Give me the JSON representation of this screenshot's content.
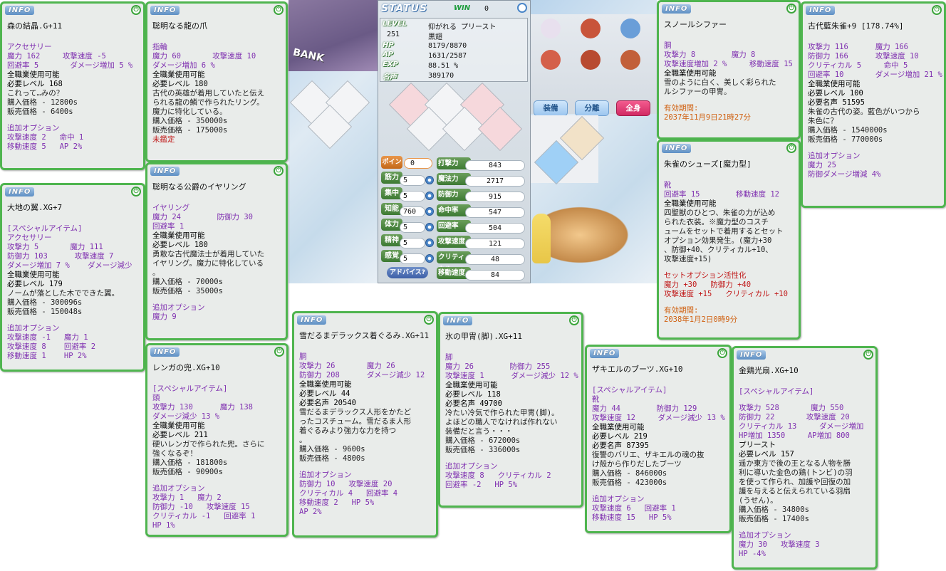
{
  "ui": {
    "info_label": "INFO",
    "power_icon": "power-icon"
  },
  "scene": {
    "bank_sign": "BANK"
  },
  "status": {
    "title": "STATUS",
    "win_label": "WIN",
    "win_value": "0",
    "level_label": "LEVEL",
    "level": "251",
    "title_text": "仰がれる プリースト",
    "name": "黒翅",
    "hp_label": "HP",
    "hp": "8179/8870",
    "ap_label": "AP",
    "ap": "1631/2587",
    "exp_label": "EXP",
    "exp": "88.51 %",
    "fame_label": "名声",
    "fame": "389170",
    "point_label": "ポイント",
    "points": "0",
    "stats": [
      {
        "label": "筋力",
        "value": "5"
      },
      {
        "label": "集中",
        "value": "5"
      },
      {
        "label": "知能",
        "value": "760"
      },
      {
        "label": "体力",
        "value": "5"
      },
      {
        "label": "精神",
        "value": "5"
      },
      {
        "label": "感覚",
        "value": "5"
      }
    ],
    "derived": [
      {
        "label": "打撃力",
        "value": "843"
      },
      {
        "label": "魔法力",
        "value": "2717"
      },
      {
        "label": "防御力",
        "value": "915"
      },
      {
        "label": "命中率",
        "value": "547"
      },
      {
        "label": "回避率",
        "value": "504"
      },
      {
        "label": "攻撃速度",
        "value": "121"
      },
      {
        "label": "クリティカル",
        "value": "48"
      },
      {
        "label": "移動速度",
        "value": "84"
      }
    ],
    "advice_button": "アドバイス?"
  },
  "equip": {
    "tab_equip": "装備",
    "tab_split": "分離",
    "tab_all": "全身"
  },
  "w1": {
    "name": "森の結晶.G+11",
    "lines": [
      {
        "t": "",
        "c": "sp"
      },
      {
        "t": "アクセサリー",
        "c": "g"
      },
      {
        "t": "魔力 162     攻撃速度 -5",
        "c": "g"
      },
      {
        "t": "回避率 5       ダメージ増加 5 %",
        "c": "g"
      },
      {
        "t": "全職業使用可能",
        "c": "b"
      },
      {
        "t": "必要レベル 168",
        "c": "b"
      },
      {
        "t": "これって…みの？",
        "c": "d"
      },
      {
        "t": "購入価格 - 12800s",
        "c": "d"
      },
      {
        "t": "販売価格 - 6400s",
        "c": "d"
      },
      {
        "t": "",
        "c": "sp"
      },
      {
        "t": "追加オプション",
        "c": "g"
      },
      {
        "t": "攻撃速度 2   命中 1",
        "c": "g"
      },
      {
        "t": "移動速度 5   AP 2%",
        "c": "g"
      }
    ]
  },
  "w2": {
    "name": "聡明なる龍の爪",
    "lines": [
      {
        "t": "",
        "c": "sp"
      },
      {
        "t": "指輪",
        "c": "g"
      },
      {
        "t": "魔力 60       攻撃速度 10",
        "c": "g"
      },
      {
        "t": "ダメージ増加 6 %",
        "c": "g"
      },
      {
        "t": "全職業使用可能",
        "c": "b"
      },
      {
        "t": "必要レベル 180",
        "c": "b"
      },
      {
        "t": "古代の英雄が着用していたと伝え",
        "c": "d"
      },
      {
        "t": "られる龍の鱗で作られたリング。",
        "c": "d"
      },
      {
        "t": "魔力に特化している。",
        "c": "d"
      },
      {
        "t": "購入価格 - 350000s",
        "c": "d"
      },
      {
        "t": "販売価格 - 175000s",
        "c": "d"
      },
      {
        "t": "未鑑定",
        "c": "r"
      }
    ]
  },
  "w3": {
    "name": "大地の翼.XG+7",
    "lines": [
      {
        "t": "",
        "c": "sp"
      },
      {
        "t": "[スペシャルアイテム]",
        "c": "g"
      },
      {
        "t": "アクセサリー",
        "c": "g"
      },
      {
        "t": "攻撃力 5       魔力 111",
        "c": "g"
      },
      {
        "t": "防御力 103      攻撃速度 7",
        "c": "g"
      },
      {
        "t": "ダメージ増加 7 %    ダメージ減少",
        "c": "g"
      },
      {
        "t": "全職業使用可能",
        "c": "b"
      },
      {
        "t": "必要レベル 179",
        "c": "b"
      },
      {
        "t": "ノームが落とした木でできた翼。",
        "c": "d"
      },
      {
        "t": "購入価格 - 300096s",
        "c": "d"
      },
      {
        "t": "販売価格 - 150048s",
        "c": "d"
      },
      {
        "t": "",
        "c": "sp"
      },
      {
        "t": "追加オプション",
        "c": "g"
      },
      {
        "t": "攻撃速度 -1   魔力 1",
        "c": "g"
      },
      {
        "t": "攻撃速度 8    回避率 2",
        "c": "g"
      },
      {
        "t": "移動速度 1    HP 2%",
        "c": "g"
      }
    ]
  },
  "w4": {
    "name": "聡明なる公爵のイヤリング",
    "lines": [
      {
        "t": "",
        "c": "sp"
      },
      {
        "t": "イヤリング",
        "c": "g"
      },
      {
        "t": "魔力 24        防御力 30",
        "c": "g"
      },
      {
        "t": "回避率 1",
        "c": "g"
      },
      {
        "t": "全職業使用可能",
        "c": "b"
      },
      {
        "t": "必要レベル 180",
        "c": "b"
      },
      {
        "t": "勇敢な古代魔法士が着用していた",
        "c": "d"
      },
      {
        "t": "イヤリング。魔力に特化している",
        "c": "d"
      },
      {
        "t": "。",
        "c": "d"
      },
      {
        "t": "購入価格 - 70000s",
        "c": "d"
      },
      {
        "t": "販売価格 - 35000s",
        "c": "d"
      },
      {
        "t": "",
        "c": "sp"
      },
      {
        "t": "追加オプション",
        "c": "g"
      },
      {
        "t": "魔力 9",
        "c": "g"
      }
    ]
  },
  "w5": {
    "name": "レンガの兜.XG+10",
    "lines": [
      {
        "t": "",
        "c": "sp"
      },
      {
        "t": "[スペシャルアイテム]",
        "c": "g"
      },
      {
        "t": "頭",
        "c": "g"
      },
      {
        "t": "攻撃力 130      魔力 138",
        "c": "g"
      },
      {
        "t": "ダメージ減少 13 %",
        "c": "g"
      },
      {
        "t": "全職業使用可能",
        "c": "b"
      },
      {
        "t": "必要レベル 211",
        "c": "b"
      },
      {
        "t": "硬いレンガで作られた兜。さらに",
        "c": "d"
      },
      {
        "t": "強くなるぞ！",
        "c": "d"
      },
      {
        "t": "購入価格 - 181800s",
        "c": "d"
      },
      {
        "t": "販売価格 - 90900s",
        "c": "d"
      },
      {
        "t": "",
        "c": "sp"
      },
      {
        "t": "追加オプション",
        "c": "g"
      },
      {
        "t": "攻撃力 1   魔力 2",
        "c": "g"
      },
      {
        "t": "防御力 -10   攻撃速度 15",
        "c": "g"
      },
      {
        "t": "クリティカル -1   回避率 1",
        "c": "g"
      },
      {
        "t": "HP 1%",
        "c": "g"
      }
    ]
  },
  "w6": {
    "name": "雪だるまデラックス着ぐるみ.XG+11",
    "lines": [
      {
        "t": "",
        "c": "sp"
      },
      {
        "t": "胴",
        "c": "g"
      },
      {
        "t": "攻撃力 26       魔力 26",
        "c": "g"
      },
      {
        "t": "防御力 208      ダメージ減少 12",
        "c": "g"
      },
      {
        "t": "全職業使用可能",
        "c": "b"
      },
      {
        "t": "必要レベル 44",
        "c": "b"
      },
      {
        "t": "必要名声 20540",
        "c": "b"
      },
      {
        "t": "雪だるまデラックス人形をかたど",
        "c": "d"
      },
      {
        "t": "ったコスチューム。雪だるま人形",
        "c": "d"
      },
      {
        "t": "着ぐるみより強力な力を持つ",
        "c": "d"
      },
      {
        "t": "。",
        "c": "d"
      },
      {
        "t": "購入価格 - 9600s",
        "c": "d"
      },
      {
        "t": "販売価格 - 4800s",
        "c": "d"
      },
      {
        "t": "",
        "c": "sp"
      },
      {
        "t": "追加オプション",
        "c": "g"
      },
      {
        "t": "防御力 10   攻撃速度 20",
        "c": "g"
      },
      {
        "t": "クリティカル 4   回避率 4",
        "c": "g"
      },
      {
        "t": "移動速度 2   HP 5%",
        "c": "g"
      },
      {
        "t": "AP 2%",
        "c": "g"
      }
    ]
  },
  "w7": {
    "name": "氷の甲冑(脚).XG+11",
    "lines": [
      {
        "t": "",
        "c": "sp"
      },
      {
        "t": "脚",
        "c": "g"
      },
      {
        "t": "魔力 26        防御力 255",
        "c": "g"
      },
      {
        "t": "攻撃速度 1      ダメージ減少 12 %",
        "c": "g"
      },
      {
        "t": "全職業使用可能",
        "c": "b"
      },
      {
        "t": "必要レベル 118",
        "c": "b"
      },
      {
        "t": "必要名声 49700",
        "c": "b"
      },
      {
        "t": "冷たい冷気で作られた甲冑(脚)。",
        "c": "d"
      },
      {
        "t": "よほどの職人でなければ作れない",
        "c": "d"
      },
      {
        "t": "装備だと言う・・・",
        "c": "d"
      },
      {
        "t": "購入価格 - 672000s",
        "c": "d"
      },
      {
        "t": "販売価格 - 336000s",
        "c": "d"
      },
      {
        "t": "",
        "c": "sp"
      },
      {
        "t": "追加オプション",
        "c": "g"
      },
      {
        "t": "攻撃速度 8   クリティカル 2",
        "c": "g"
      },
      {
        "t": "回避率 -2   HP 5%",
        "c": "g"
      }
    ]
  },
  "w8": {
    "name": "ザキエルのブーツ.XG+10",
    "lines": [
      {
        "t": "",
        "c": "sp"
      },
      {
        "t": "[スペシャルアイテム]",
        "c": "g"
      },
      {
        "t": "靴",
        "c": "g"
      },
      {
        "t": "魔力 44        防御力 129",
        "c": "g"
      },
      {
        "t": "攻撃速度 12     ダメージ減少 13 %",
        "c": "g"
      },
      {
        "t": "全職業使用可能",
        "c": "b"
      },
      {
        "t": "必要レベル 219",
        "c": "b"
      },
      {
        "t": "必要名声 87395",
        "c": "b"
      },
      {
        "t": "復讐のバリエ、ザキエルの魂の抜",
        "c": "d"
      },
      {
        "t": "け殻から作りだしたブーツ",
        "c": "d"
      },
      {
        "t": "購入価格 - 846000s",
        "c": "d"
      },
      {
        "t": "販売価格 - 423000s",
        "c": "d"
      },
      {
        "t": "",
        "c": "sp"
      },
      {
        "t": "追加オプション",
        "c": "g"
      },
      {
        "t": "攻撃速度 6   回避率 1",
        "c": "g"
      },
      {
        "t": "移動速度 15   HP 5%",
        "c": "g"
      }
    ]
  },
  "w9": {
    "name": "スノールシファー",
    "lines": [
      {
        "t": "",
        "c": "sp"
      },
      {
        "t": "胴",
        "c": "g"
      },
      {
        "t": "攻撃力 8        魔力 8",
        "c": "g"
      },
      {
        "t": "攻撃速度増加 2 %     移動速度 15",
        "c": "g"
      },
      {
        "t": "全職業使用可能",
        "c": "b"
      },
      {
        "t": "雪のように白く、美しく彩られた",
        "c": "d"
      },
      {
        "t": "ルシファーの甲冑。",
        "c": "d"
      },
      {
        "t": "",
        "c": "sp"
      },
      {
        "t": "有効期間:",
        "c": "o"
      },
      {
        "t": "2037年11月9日21時27分",
        "c": "o"
      }
    ]
  },
  "w10": {
    "name": "朱雀のシューズ[魔力型]",
    "lines": [
      {
        "t": "",
        "c": "sp"
      },
      {
        "t": "靴",
        "c": "g"
      },
      {
        "t": "回避率 15        移動速度 12",
        "c": "g"
      },
      {
        "t": "全職業使用可能",
        "c": "b"
      },
      {
        "t": "四聖獣のひとつ、朱雀の力が込め",
        "c": "d"
      },
      {
        "t": "られた衣装。※魔力型のコスチ",
        "c": "d"
      },
      {
        "t": "ュームをセットで着用するとセット",
        "c": "d"
      },
      {
        "t": "オプション効果発生。(魔力+30",
        "c": "d"
      },
      {
        "t": "、防御+40、クリティカル+10、",
        "c": "d"
      },
      {
        "t": "攻撃速度+15)",
        "c": "d"
      },
      {
        "t": "",
        "c": "sp"
      },
      {
        "t": "セットオプション活性化",
        "c": "r"
      },
      {
        "t": "魔力 +30   防御力 +40",
        "c": "r"
      },
      {
        "t": "攻撃速度 +15   クリティカル +10",
        "c": "r"
      },
      {
        "t": "",
        "c": "sp"
      },
      {
        "t": "有効期間:",
        "c": "o"
      },
      {
        "t": "2038年1月2日0時9分",
        "c": "o"
      }
    ]
  },
  "w11": {
    "name": "古代藍朱雀+9 [178.74%]",
    "lines": [
      {
        "t": "",
        "c": "sp"
      },
      {
        "t": "攻撃力 116      魔力 166",
        "c": "g"
      },
      {
        "t": "防御力 166      攻撃速度 10",
        "c": "g"
      },
      {
        "t": "クリティカル 5     命中 5",
        "c": "g"
      },
      {
        "t": "回避率 10       ダメージ増加 21 %",
        "c": "g"
      },
      {
        "t": "全職業使用可能",
        "c": "b"
      },
      {
        "t": "必要レベル 100",
        "c": "b"
      },
      {
        "t": "必要名声 51595",
        "c": "b"
      },
      {
        "t": "朱雀の古代の姿。藍色がいつから",
        "c": "d"
      },
      {
        "t": "朱色に？",
        "c": "d"
      },
      {
        "t": "購入価格 - 1540000s",
        "c": "d"
      },
      {
        "t": "販売価格 - 770000s",
        "c": "d"
      },
      {
        "t": "",
        "c": "sp"
      },
      {
        "t": "追加オプション",
        "c": "g"
      },
      {
        "t": "魔力 25",
        "c": "g"
      },
      {
        "t": "防御ダメージ増減 4%",
        "c": "g"
      }
    ]
  },
  "w12": {
    "name": "金鶏光扇.XG+10",
    "lines": [
      {
        "t": "",
        "c": "sp"
      },
      {
        "t": "[スペシャルアイテム]",
        "c": "g"
      },
      {
        "t": "",
        "c": "sp"
      },
      {
        "t": "攻撃力 528       魔力 550",
        "c": "g"
      },
      {
        "t": "防御力 22       攻撃速度 20",
        "c": "g"
      },
      {
        "t": "クリティカル 13     ダメージ増加",
        "c": "g"
      },
      {
        "t": "HP増加 1350     AP増加 800",
        "c": "g"
      },
      {
        "t": "プリースト",
        "c": "b"
      },
      {
        "t": "必要レベル 157",
        "c": "b"
      },
      {
        "t": "遥か東方で後の王となる人物を勝",
        "c": "d"
      },
      {
        "t": "利に導いた金色の鶏(トンビ)の羽",
        "c": "d"
      },
      {
        "t": "を使って作られ、加護や回復の加",
        "c": "d"
      },
      {
        "t": "護を与えると伝えられている羽扇",
        "c": "d"
      },
      {
        "t": "(うせん)。",
        "c": "d"
      },
      {
        "t": "購入価格 - 34800s",
        "c": "d"
      },
      {
        "t": "販売価格 - 17400s",
        "c": "d"
      },
      {
        "t": "",
        "c": "sp"
      },
      {
        "t": "追加オプション",
        "c": "g"
      },
      {
        "t": "魔力 30   攻撃速度 3",
        "c": "g"
      },
      {
        "t": "HP -4%",
        "c": "g"
      }
    ]
  }
}
